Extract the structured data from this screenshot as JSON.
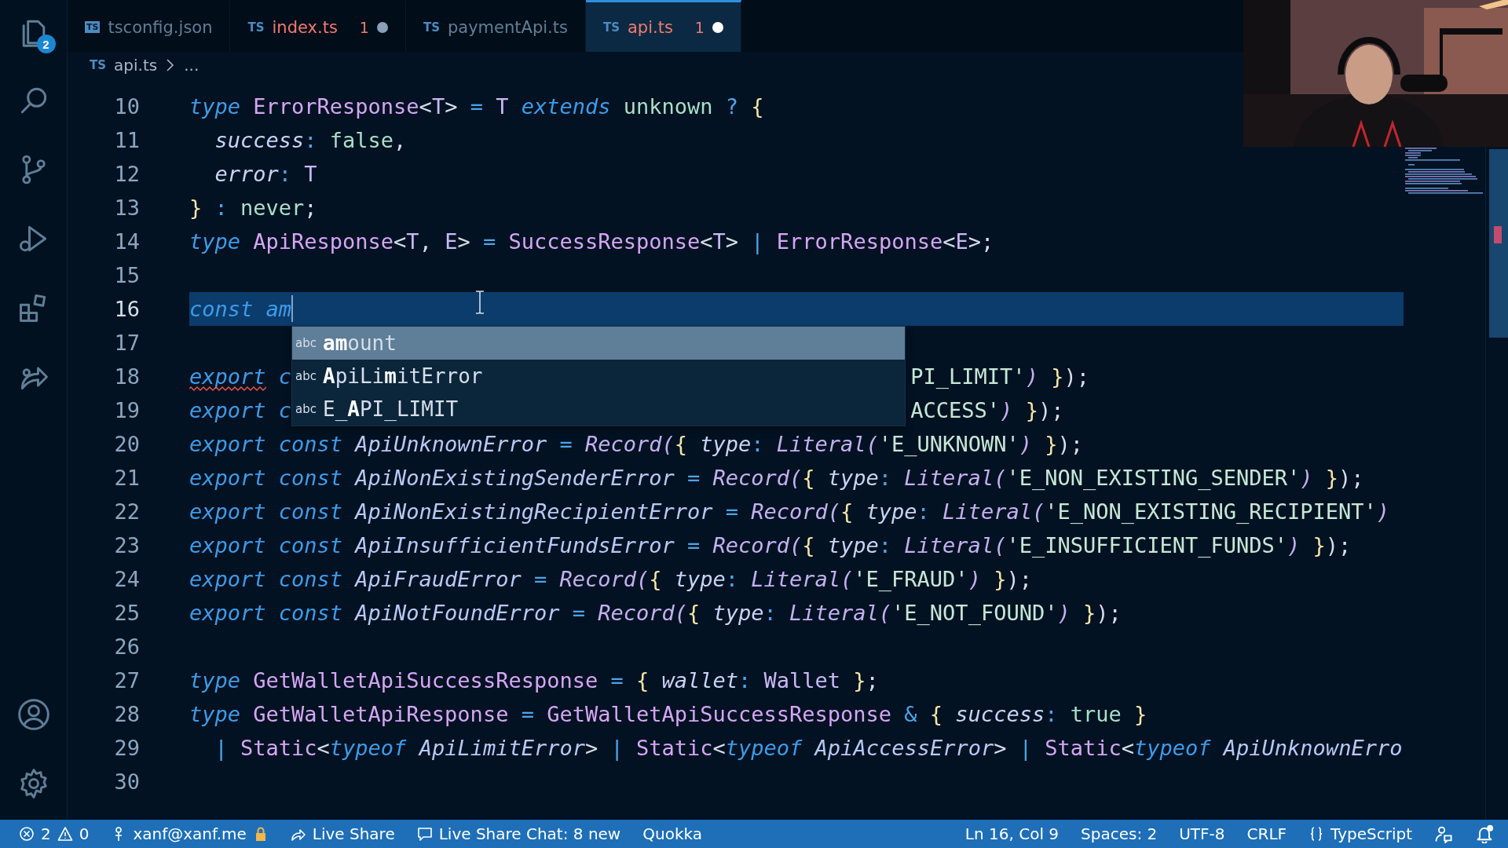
{
  "activity_bar": {
    "items": [
      {
        "kind": "files",
        "badge": "2",
        "selected": false
      },
      {
        "kind": "search",
        "selected": false
      },
      {
        "kind": "source_control",
        "selected": false
      },
      {
        "kind": "run",
        "selected": false
      },
      {
        "kind": "extensions",
        "selected": false
      },
      {
        "kind": "live_share",
        "selected": false
      }
    ],
    "bottom": [
      {
        "kind": "account"
      },
      {
        "kind": "settings"
      }
    ]
  },
  "tabs": [
    {
      "label": "tsconfig.json",
      "kind": "config",
      "icon_text": "TS",
      "selected": false,
      "error": false,
      "dirty": false
    },
    {
      "label": "index.ts",
      "kind": "source",
      "icon_text": "TS",
      "selected": false,
      "error": true,
      "problems": "1",
      "dirty": true
    },
    {
      "label": "paymentApi.ts",
      "kind": "source",
      "icon_text": "TS",
      "selected": false,
      "error": false,
      "dirty": false
    },
    {
      "label": "api.ts",
      "kind": "source",
      "icon_text": "TS",
      "selected": true,
      "error": true,
      "problems": "1",
      "dirty": true
    }
  ],
  "breadcrumb": {
    "icon_text": "TS",
    "items": [
      "api.ts",
      "..."
    ]
  },
  "editor": {
    "lines": [
      {
        "number": "10",
        "tokens": [
          {
            "kind": "kw",
            "text": "type "
          },
          {
            "kind": "type",
            "text": "ErrorResponse"
          },
          {
            "kind": "plain",
            "text": "<"
          },
          {
            "kind": "tparam",
            "text": "T"
          },
          {
            "kind": "plain",
            "text": "> "
          },
          {
            "kind": "op",
            "text": "= "
          },
          {
            "kind": "tparam",
            "text": "T "
          },
          {
            "kind": "kw",
            "text": "extends "
          },
          {
            "kind": "const",
            "text": "unknown "
          },
          {
            "kind": "op",
            "text": "? "
          },
          {
            "kind": "brace",
            "text": "{"
          }
        ]
      },
      {
        "number": "11",
        "tokens": [
          {
            "kind": "prop",
            "text": "  success"
          },
          {
            "kind": "op",
            "text": ": "
          },
          {
            "kind": "const",
            "text": "false"
          },
          {
            "kind": "plain",
            "text": ","
          }
        ]
      },
      {
        "number": "12",
        "tokens": [
          {
            "kind": "prop",
            "text": "  error"
          },
          {
            "kind": "op",
            "text": ": "
          },
          {
            "kind": "tparam",
            "text": "T"
          }
        ]
      },
      {
        "number": "13",
        "tokens": [
          {
            "kind": "brace",
            "text": "}"
          },
          {
            "kind": "op",
            "text": " : "
          },
          {
            "kind": "const",
            "text": "never"
          },
          {
            "kind": "plain",
            "text": ";"
          }
        ]
      },
      {
        "number": "14",
        "tokens": [
          {
            "kind": "kw",
            "text": "type "
          },
          {
            "kind": "type",
            "text": "ApiResponse"
          },
          {
            "kind": "plain",
            "text": "<"
          },
          {
            "kind": "tparam",
            "text": "T"
          },
          {
            "kind": "plain",
            "text": ", "
          },
          {
            "kind": "tparam",
            "text": "E"
          },
          {
            "kind": "plain",
            "text": "> "
          },
          {
            "kind": "op",
            "text": "= "
          },
          {
            "kind": "type",
            "text": "SuccessResponse"
          },
          {
            "kind": "plain",
            "text": "<"
          },
          {
            "kind": "tparam",
            "text": "T"
          },
          {
            "kind": "plain",
            "text": "> "
          },
          {
            "kind": "op",
            "text": "| "
          },
          {
            "kind": "type",
            "text": "ErrorResponse"
          },
          {
            "kind": "plain",
            "text": "<"
          },
          {
            "kind": "tparam",
            "text": "E"
          },
          {
            "kind": "plain",
            "text": ">;"
          }
        ]
      },
      {
        "number": "15"
      },
      {
        "number": "16",
        "current": true,
        "cursor": true,
        "tokens": [
          {
            "kind": "kw",
            "text": "const "
          },
          {
            "kind": "kw",
            "text": "am"
          }
        ]
      },
      {
        "number": "17"
      },
      {
        "number": "18",
        "tokens": [
          {
            "kind": "kw",
            "text": "export",
            "error": true
          },
          {
            "kind": "kw",
            "text": " c"
          }
        ],
        "tokens_right": [
          {
            "kind": "str",
            "text": "PI_LIMIT'"
          },
          {
            "kind": "fn",
            "text": ") "
          },
          {
            "kind": "brace",
            "text": "}"
          },
          {
            "kind": "plain",
            "text": ");"
          }
        ]
      },
      {
        "number": "19",
        "tokens": [
          {
            "kind": "kw",
            "text": "export"
          },
          {
            "kind": "kw",
            "text": " c"
          }
        ],
        "tokens_right": [
          {
            "kind": "str",
            "text": "ACCESS'"
          },
          {
            "kind": "fn",
            "text": ") "
          },
          {
            "kind": "brace",
            "text": "}"
          },
          {
            "kind": "plain",
            "text": ");"
          }
        ]
      },
      {
        "number": "20",
        "tokens": [
          {
            "kind": "kw",
            "text": "export const "
          },
          {
            "kind": "var",
            "text": "ApiUnknownError "
          },
          {
            "kind": "op",
            "text": "= "
          },
          {
            "kind": "fn",
            "text": "Record("
          },
          {
            "kind": "brace",
            "text": "{ "
          },
          {
            "kind": "prop",
            "text": "type"
          },
          {
            "kind": "op",
            "text": ": "
          },
          {
            "kind": "fn",
            "text": "Literal("
          },
          {
            "kind": "str",
            "text": "'E_UNKNOWN'"
          },
          {
            "kind": "fn",
            "text": ") "
          },
          {
            "kind": "brace",
            "text": "}"
          },
          {
            "kind": "plain",
            "text": ");"
          }
        ]
      },
      {
        "number": "21",
        "tokens": [
          {
            "kind": "kw",
            "text": "export const "
          },
          {
            "kind": "var",
            "text": "ApiNonExistingSenderError "
          },
          {
            "kind": "op",
            "text": "= "
          },
          {
            "kind": "fn",
            "text": "Record("
          },
          {
            "kind": "brace",
            "text": "{ "
          },
          {
            "kind": "prop",
            "text": "type"
          },
          {
            "kind": "op",
            "text": ": "
          },
          {
            "kind": "fn",
            "text": "Literal("
          },
          {
            "kind": "str",
            "text": "'E_NON_EXISTING_SENDER'"
          },
          {
            "kind": "fn",
            "text": ") "
          },
          {
            "kind": "brace",
            "text": "}"
          },
          {
            "kind": "plain",
            "text": ");"
          }
        ]
      },
      {
        "number": "22",
        "tokens": [
          {
            "kind": "kw",
            "text": "export const "
          },
          {
            "kind": "var",
            "text": "ApiNonExistingRecipientError "
          },
          {
            "kind": "op",
            "text": "= "
          },
          {
            "kind": "fn",
            "text": "Record("
          },
          {
            "kind": "brace",
            "text": "{ "
          },
          {
            "kind": "prop",
            "text": "type"
          },
          {
            "kind": "op",
            "text": ": "
          },
          {
            "kind": "fn",
            "text": "Literal("
          },
          {
            "kind": "str",
            "text": "'E_NON_EXISTING_RECIPIENT'"
          },
          {
            "kind": "fn",
            "text": ")"
          }
        ]
      },
      {
        "number": "23",
        "tokens": [
          {
            "kind": "kw",
            "text": "export const "
          },
          {
            "kind": "var",
            "text": "ApiInsufficientFundsError "
          },
          {
            "kind": "op",
            "text": "= "
          },
          {
            "kind": "fn",
            "text": "Record("
          },
          {
            "kind": "brace",
            "text": "{ "
          },
          {
            "kind": "prop",
            "text": "type"
          },
          {
            "kind": "op",
            "text": ": "
          },
          {
            "kind": "fn",
            "text": "Literal("
          },
          {
            "kind": "str",
            "text": "'E_INSUFFICIENT_FUNDS'"
          },
          {
            "kind": "fn",
            "text": ") "
          },
          {
            "kind": "brace",
            "text": "}"
          },
          {
            "kind": "plain",
            "text": ");"
          }
        ]
      },
      {
        "number": "24",
        "tokens": [
          {
            "kind": "kw",
            "text": "export const "
          },
          {
            "kind": "var",
            "text": "ApiFraudError "
          },
          {
            "kind": "op",
            "text": "= "
          },
          {
            "kind": "fn",
            "text": "Record("
          },
          {
            "kind": "brace",
            "text": "{ "
          },
          {
            "kind": "prop",
            "text": "type"
          },
          {
            "kind": "op",
            "text": ": "
          },
          {
            "kind": "fn",
            "text": "Literal("
          },
          {
            "kind": "str",
            "text": "'E_FRAUD'"
          },
          {
            "kind": "fn",
            "text": ") "
          },
          {
            "kind": "brace",
            "text": "}"
          },
          {
            "kind": "plain",
            "text": ");"
          }
        ]
      },
      {
        "number": "25",
        "tokens": [
          {
            "kind": "kw",
            "text": "export const "
          },
          {
            "kind": "var",
            "text": "ApiNotFoundError "
          },
          {
            "kind": "op",
            "text": "= "
          },
          {
            "kind": "fn",
            "text": "Record("
          },
          {
            "kind": "brace",
            "text": "{ "
          },
          {
            "kind": "prop",
            "text": "type"
          },
          {
            "kind": "op",
            "text": ": "
          },
          {
            "kind": "fn",
            "text": "Literal("
          },
          {
            "kind": "str",
            "text": "'E_NOT_FOUND'"
          },
          {
            "kind": "fn",
            "text": ") "
          },
          {
            "kind": "brace",
            "text": "}"
          },
          {
            "kind": "plain",
            "text": ");"
          }
        ]
      },
      {
        "number": "26"
      },
      {
        "number": "27",
        "tokens": [
          {
            "kind": "kw",
            "text": "type "
          },
          {
            "kind": "type",
            "text": "GetWalletApiSuccessResponse "
          },
          {
            "kind": "op",
            "text": "= "
          },
          {
            "kind": "brace",
            "text": "{ "
          },
          {
            "kind": "prop",
            "text": "wallet"
          },
          {
            "kind": "op",
            "text": ": "
          },
          {
            "kind": "tparam",
            "text": "Wallet "
          },
          {
            "kind": "brace",
            "text": "}"
          },
          {
            "kind": "plain",
            "text": ";"
          }
        ]
      },
      {
        "number": "28",
        "tokens": [
          {
            "kind": "kw",
            "text": "type "
          },
          {
            "kind": "type",
            "text": "GetWalletApiResponse "
          },
          {
            "kind": "op",
            "text": "= "
          },
          {
            "kind": "type",
            "text": "GetWalletApiSuccessResponse "
          },
          {
            "kind": "op",
            "text": "& "
          },
          {
            "kind": "brace",
            "text": "{ "
          },
          {
            "kind": "prop",
            "text": "success"
          },
          {
            "kind": "op",
            "text": ": "
          },
          {
            "kind": "const",
            "text": "true "
          },
          {
            "kind": "brace",
            "text": "}"
          }
        ]
      },
      {
        "number": "29",
        "tokens": [
          {
            "kind": "op",
            "text": "  | "
          },
          {
            "kind": "type",
            "text": "Static"
          },
          {
            "kind": "plain",
            "text": "<"
          },
          {
            "kind": "kw",
            "text": "typeof "
          },
          {
            "kind": "var",
            "text": "ApiLimitError"
          },
          {
            "kind": "plain",
            "text": "> "
          },
          {
            "kind": "op",
            "text": "| "
          },
          {
            "kind": "type",
            "text": "Static"
          },
          {
            "kind": "plain",
            "text": "<"
          },
          {
            "kind": "kw",
            "text": "typeof "
          },
          {
            "kind": "var",
            "text": "ApiAccessError"
          },
          {
            "kind": "plain",
            "text": "> "
          },
          {
            "kind": "op",
            "text": "| "
          },
          {
            "kind": "type",
            "text": "Static"
          },
          {
            "kind": "plain",
            "text": "<"
          },
          {
            "kind": "kw",
            "text": "typeof "
          },
          {
            "kind": "var",
            "text": "ApiUnknownErro"
          }
        ]
      },
      {
        "number": "30"
      }
    ],
    "suggestions": [
      {
        "icon_text": "abc",
        "label": "**am**ount",
        "selected": true
      },
      {
        "icon_text": "abc",
        "label": "**A**piLi**m**itError",
        "selected": false
      },
      {
        "icon_text": "abc",
        "label": "E_**A**PI_LIMIT",
        "selected": false
      }
    ]
  },
  "status_bar": {
    "left": [
      {
        "kind": "problems",
        "errors": "2",
        "warnings": "0"
      },
      {
        "kind": "account",
        "text": "xanf@xanf.me"
      },
      {
        "kind": "live_share",
        "text": "Live Share"
      },
      {
        "kind": "chat",
        "text": "Live Share Chat: 8 new"
      },
      {
        "kind": "plain",
        "text": "Quokka"
      }
    ],
    "right": [
      {
        "kind": "plain",
        "text": "Ln 16, Col 9"
      },
      {
        "kind": "plain",
        "text": "Spaces: 2"
      },
      {
        "kind": "plain",
        "text": "UTF-8"
      },
      {
        "kind": "plain",
        "text": "CRLF"
      },
      {
        "kind": "language",
        "text": "TypeScript"
      },
      {
        "kind": "feedback"
      },
      {
        "kind": "bell"
      }
    ]
  }
}
